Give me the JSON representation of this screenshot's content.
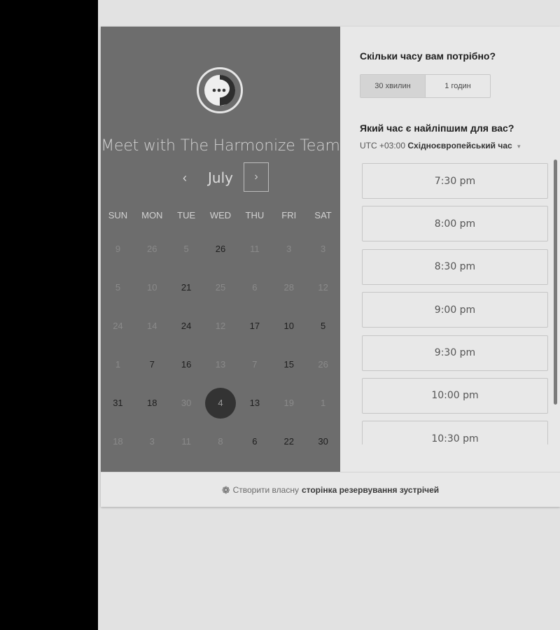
{
  "host": {
    "title": "Meet with The Harmonize Team",
    "avatar_icon": "chat-bubble-icon"
  },
  "calendar": {
    "month": "July",
    "prev_icon": "chevron-left-icon",
    "next_icon": "chevron-right-icon",
    "prev_glyph": "‹",
    "next_glyph": "›",
    "weekdays": [
      "SUN",
      "MON",
      "TUE",
      "WED",
      "THU",
      "FRI",
      "SAT"
    ],
    "weeks": [
      [
        {
          "d": "9",
          "on": false
        },
        {
          "d": "26",
          "on": false
        },
        {
          "d": "5",
          "on": false
        },
        {
          "d": "26",
          "on": true
        },
        {
          "d": "11",
          "on": false
        },
        {
          "d": "3",
          "on": false
        },
        {
          "d": "3",
          "on": false
        }
      ],
      [
        {
          "d": "5",
          "on": false
        },
        {
          "d": "10",
          "on": false
        },
        {
          "d": "21",
          "on": true
        },
        {
          "d": "25",
          "on": false
        },
        {
          "d": "6",
          "on": false
        },
        {
          "d": "28",
          "on": false
        },
        {
          "d": "12",
          "on": false
        }
      ],
      [
        {
          "d": "24",
          "on": false
        },
        {
          "d": "14",
          "on": false
        },
        {
          "d": "24",
          "on": true
        },
        {
          "d": "12",
          "on": false
        },
        {
          "d": "17",
          "on": true
        },
        {
          "d": "10",
          "on": true
        },
        {
          "d": "5",
          "on": true
        }
      ],
      [
        {
          "d": "1",
          "on": false
        },
        {
          "d": "7",
          "on": true
        },
        {
          "d": "16",
          "on": true
        },
        {
          "d": "13",
          "on": false
        },
        {
          "d": "7",
          "on": false
        },
        {
          "d": "15",
          "on": true
        },
        {
          "d": "26",
          "on": false
        }
      ],
      [
        {
          "d": "31",
          "on": true
        },
        {
          "d": "18",
          "on": true
        },
        {
          "d": "30",
          "on": false
        },
        {
          "d": "4",
          "on": true,
          "selected": true
        },
        {
          "d": "13",
          "on": true
        },
        {
          "d": "19",
          "on": false
        },
        {
          "d": "1",
          "on": false
        }
      ],
      [
        {
          "d": "18",
          "on": false
        },
        {
          "d": "3",
          "on": false
        },
        {
          "d": "11",
          "on": false
        },
        {
          "d": "8",
          "on": false
        },
        {
          "d": "6",
          "on": true
        },
        {
          "d": "22",
          "on": true
        },
        {
          "d": "30",
          "on": true
        }
      ]
    ]
  },
  "duration": {
    "question": "Скільки часу вам потрібно?",
    "options": [
      "30 хвилин",
      "1 годин"
    ],
    "selected_index": 0
  },
  "time": {
    "question": "Який час є найліпшим для вас?",
    "timezone_prefix": "UTC +03:00",
    "timezone_name": "Східноєвропейський час",
    "caret": "▾",
    "slots": [
      "7:30 pm",
      "8:00 pm",
      "8:30 pm",
      "9:00 pm",
      "9:30 pm",
      "10:00 pm",
      "10:30 pm"
    ]
  },
  "footer": {
    "icon": "sprocket-icon",
    "prefix": "Створити власну",
    "link": "сторінка резервування зустрічей"
  },
  "colors": {
    "left_panel": "#6d6d6d",
    "selected_day": "#333333",
    "right_panel": "#e8e8e8"
  }
}
